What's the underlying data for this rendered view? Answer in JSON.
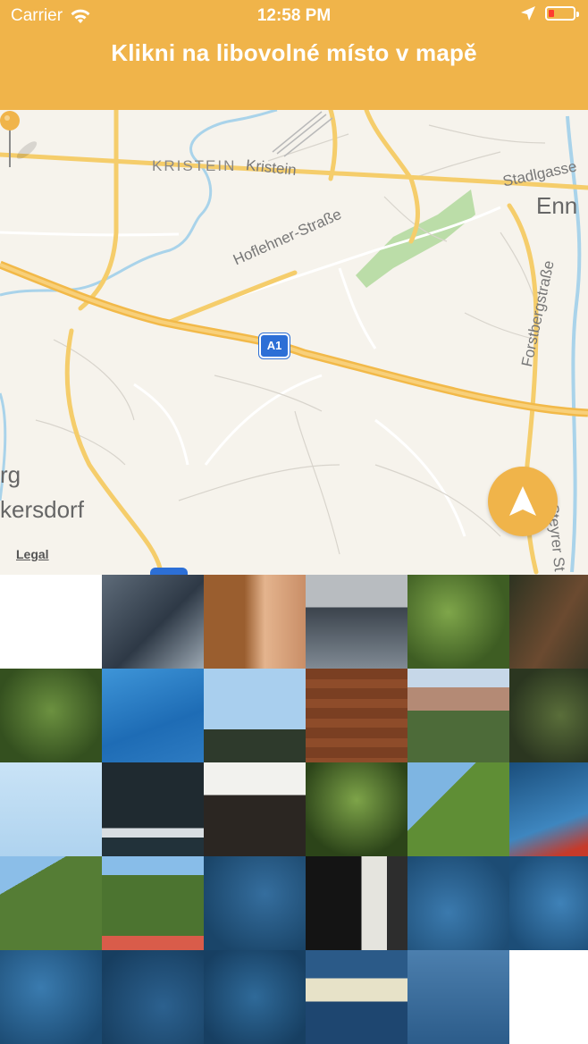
{
  "status_bar": {
    "carrier": "Carrier",
    "time": "12:58 PM"
  },
  "header": {
    "title": "Klikni na libovolné místo v mapě"
  },
  "map": {
    "labels": [
      "KRISTEIN",
      "Kristein",
      "Stadlgasse",
      "Enn",
      "Hoflehner-Straße",
      "Forstbergstraße",
      "rg",
      "kersdorf",
      "Steyrer St"
    ],
    "highway_shield": "A1",
    "legal_link": "Legal",
    "pin_color": "#F0B44A"
  },
  "puzzle": {
    "columns": 6,
    "tiles": [
      {
        "name": "tile-empty",
        "bg": "#ffffff"
      },
      {
        "name": "tile-pool-number",
        "bg": "linear-gradient(135deg,#5E6B79,#2E3946 55%,#9CA8B3)"
      },
      {
        "name": "tile-arm",
        "bg": "linear-gradient(90deg,#9A5E2F 0 40%,#E4B48E 60%,#C98E67)"
      },
      {
        "name": "tile-railing",
        "bg": "linear-gradient(180deg,#B8BCC0 0 35%,#3B434C 35%,#808A94)"
      },
      {
        "name": "tile-leaves",
        "bg": "radial-gradient(circle at 40% 40%,#7FA64A,#3E5D23 70%)"
      },
      {
        "name": "tile-dark-wood",
        "bg": "linear-gradient(120deg,#2D3321,#6B4A30 50%,#2A3021)"
      },
      {
        "name": "tile-leaves-2",
        "bg": "radial-gradient(circle at 50% 45%,#6C9140,#34501F 75%)"
      },
      {
        "name": "tile-blue-cloth",
        "bg": "linear-gradient(160deg,#3E95D8,#1E6CB5 60%,#2D7BC2)"
      },
      {
        "name": "tile-sky-trees",
        "bg": "linear-gradient(180deg,#A9CFEE 0 65%,#2E3A2C 65%)"
      },
      {
        "name": "tile-wood",
        "bg": "repeating-linear-gradient(180deg,#7A3F22 0 12px,#8E4C2A 12px 22px)"
      },
      {
        "name": "tile-house",
        "bg": "linear-gradient(180deg,#C6D7E8 0 20%,#B48A75 20% 45%,#4D6B39 45%)"
      },
      {
        "name": "tile-blur-green",
        "bg": "radial-gradient(circle at 50% 50%,#5A6E3A,#2B3620 75%)"
      },
      {
        "name": "tile-sky",
        "bg": "linear-gradient(180deg,#C9E3F6,#AFD3EF)"
      },
      {
        "name": "tile-flags",
        "bg": "linear-gradient(180deg,#1F2A30 0 70%,#D8DEE2 70% 80%,#22323A 80%)"
      },
      {
        "name": "tile-umbrella",
        "bg": "linear-gradient(180deg,#F2F2EE 0 35%,#2B2622 35%)"
      },
      {
        "name": "tile-fern",
        "bg": "radial-gradient(circle at 50% 40%,#7EA449,#2C4419 75%)"
      },
      {
        "name": "tile-tree-sky",
        "bg": "linear-gradient(135deg,#7EB5E2 0 35%,#5F8E35 35%)"
      },
      {
        "name": "tile-water-red",
        "bg": "linear-gradient(160deg,#1A4E7C,#3E86BF 60%,#C63A2A 85%)"
      },
      {
        "name": "tile-tree-2",
        "bg": "linear-gradient(150deg,#8BBEE8 0 25%,#557D35 25%)"
      },
      {
        "name": "tile-tree-umbrella",
        "bg": "linear-gradient(180deg,#88BDE9 0 20%,#4C7430 20% 85%,#D95C4A 85%)"
      },
      {
        "name": "tile-water",
        "bg": "radial-gradient(circle at 60% 40%,#356E9E,#1A4569 80%)"
      },
      {
        "name": "tile-dark-door",
        "bg": "linear-gradient(90deg,#141414 0 55%,#E5E4DE 55% 80%,#2D2D2D 80%)"
      },
      {
        "name": "tile-water-2",
        "bg": "radial-gradient(circle at 40% 60%,#3B7AAE,#1D4C74 80%)"
      },
      {
        "name": "tile-water-3",
        "bg": "radial-gradient(circle at 50% 50%,#3F82B8,#1C4D77 85%)"
      },
      {
        "name": "tile-water-4",
        "bg": "radial-gradient(circle at 40% 40%,#3A7BAF,#1B4A72 85%)"
      },
      {
        "name": "tile-water-5",
        "bg": "radial-gradient(circle at 60% 60%,#2C618F,#173E60 85%)"
      },
      {
        "name": "tile-water-6",
        "bg": "radial-gradient(circle at 50% 50%,#2F6A99,#173F62 85%),linear-gradient(#000,#000)"
      },
      {
        "name": "tile-blur-boat",
        "bg": "linear-gradient(180deg,#2B5A88 0 30%,#E7E2C8 30% 55%,#1E4670 55%)"
      },
      {
        "name": "tile-water-blur",
        "bg": "linear-gradient(180deg,#4C7FAE,#2C5C8A)"
      },
      {
        "name": "tile-empty-2",
        "bg": "#ffffff"
      }
    ]
  }
}
